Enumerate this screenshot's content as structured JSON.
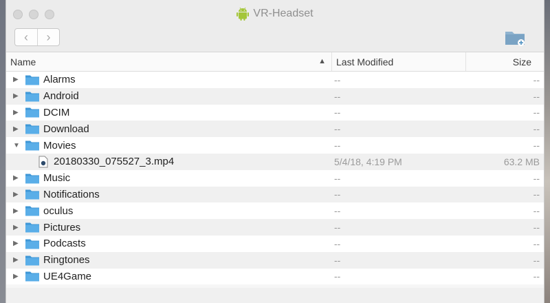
{
  "window": {
    "title": "VR-Headset",
    "title_icon": "android-icon"
  },
  "toolbar": {
    "back_glyph": "‹",
    "forward_glyph": "›",
    "new_folder_icon": "new-folder-icon"
  },
  "columns": {
    "name": "Name",
    "modified": "Last Modified",
    "size": "Size",
    "sort_indicator": "^"
  },
  "rows": [
    {
      "name": "Alarms",
      "modified": "--",
      "size": "--",
      "type": "folder",
      "expanded": false
    },
    {
      "name": "Android",
      "modified": "--",
      "size": "--",
      "type": "folder",
      "expanded": false
    },
    {
      "name": "DCIM",
      "modified": "--",
      "size": "--",
      "type": "folder",
      "expanded": false
    },
    {
      "name": "Download",
      "modified": "--",
      "size": "--",
      "type": "folder",
      "expanded": false
    },
    {
      "name": "Movies",
      "modified": "--",
      "size": "--",
      "type": "folder",
      "expanded": true
    },
    {
      "name": "20180330_075527_3.mp4",
      "modified": "5/4/18, 4:19 PM",
      "size": "63.2 MB",
      "type": "file",
      "child": true
    },
    {
      "name": "Music",
      "modified": "--",
      "size": "--",
      "type": "folder",
      "expanded": false
    },
    {
      "name": "Notifications",
      "modified": "--",
      "size": "--",
      "type": "folder",
      "expanded": false
    },
    {
      "name": "oculus",
      "modified": "--",
      "size": "--",
      "type": "folder",
      "expanded": false
    },
    {
      "name": "Pictures",
      "modified": "--",
      "size": "--",
      "type": "folder",
      "expanded": false
    },
    {
      "name": "Podcasts",
      "modified": "--",
      "size": "--",
      "type": "folder",
      "expanded": false
    },
    {
      "name": "Ringtones",
      "modified": "--",
      "size": "--",
      "type": "folder",
      "expanded": false
    },
    {
      "name": "UE4Game",
      "modified": "--",
      "size": "--",
      "type": "folder",
      "expanded": false
    }
  ],
  "colors": {
    "folder": "#5aaee8",
    "folder_dark": "#3f97d6",
    "android_green": "#a4c639"
  }
}
